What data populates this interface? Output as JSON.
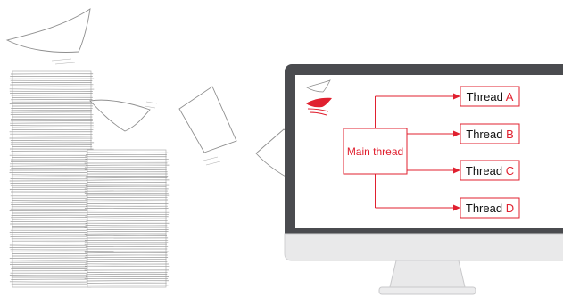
{
  "diagram": {
    "main_node": {
      "label": "Main thread"
    },
    "threads": [
      {
        "prefix": "Thread ",
        "letter": "A"
      },
      {
        "prefix": "Thread ",
        "letter": "B"
      },
      {
        "prefix": "Thread ",
        "letter": "C"
      },
      {
        "prefix": "Thread ",
        "letter": "D"
      }
    ]
  },
  "colors": {
    "accent": "#e0202f",
    "paper_stroke": "#9a9a9a",
    "monitor_bezel": "#4a4b4f",
    "monitor_stand": "#e9e9ea",
    "screen": "#ffffff"
  }
}
